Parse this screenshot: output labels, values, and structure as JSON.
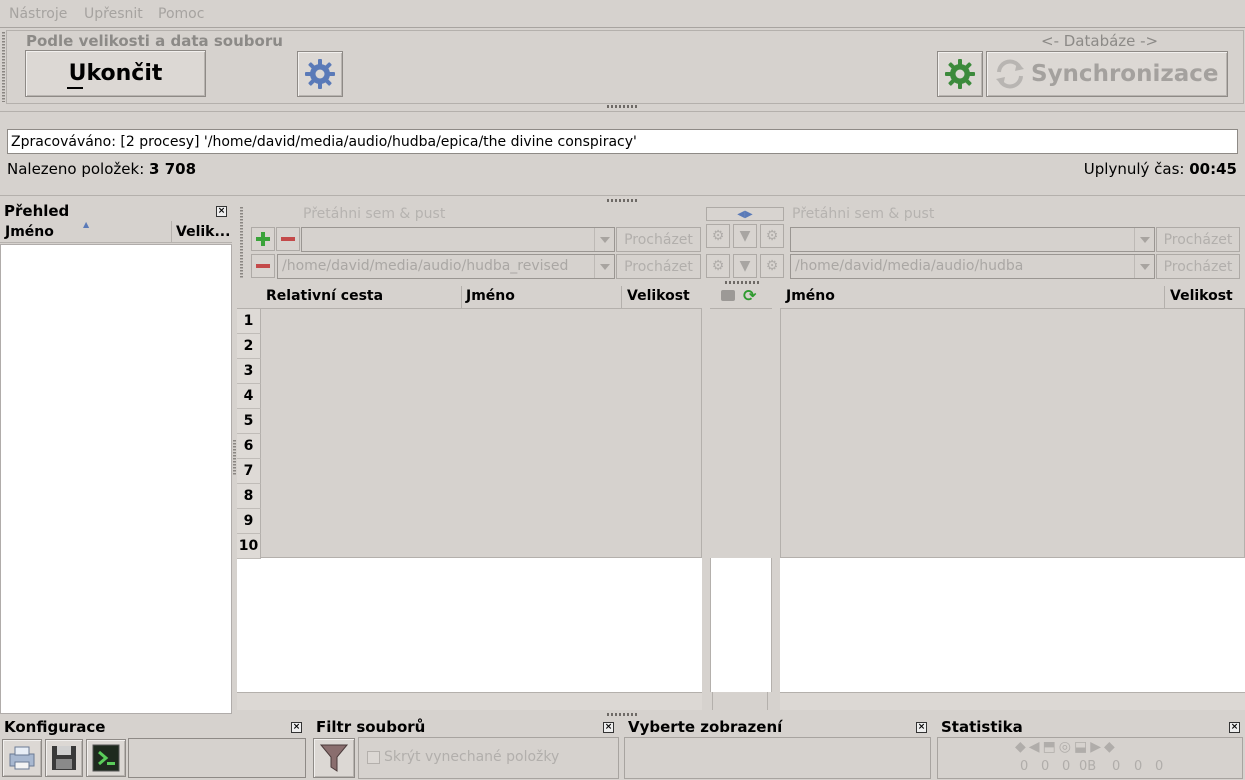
{
  "menu": {
    "items": [
      {
        "label": "Nástroje"
      },
      {
        "label": "Upřesnit"
      },
      {
        "label": "Pomoc"
      }
    ]
  },
  "toolbar": {
    "compare_mode": "Podle velikosti a data souboru",
    "quit_label": "Ukončit",
    "database_label": "<- Databáze ->",
    "sync_label": "Synchronizace"
  },
  "status": {
    "processing_text": "Zpracováváno: [2 procesy] '/home/david/media/audio/hudba/epica/the divine conspiracy'",
    "found_label": "Nalezeno položek:",
    "found_value": "3 708",
    "elapsed_label": "Uplynulý čas:",
    "elapsed_value": "00:45"
  },
  "overview": {
    "title": "Přehled",
    "col_name": "Jméno",
    "col_size": "Velik..."
  },
  "left_side": {
    "drop_hint": "Přetáhni sem & pust",
    "path_top": "",
    "path_bottom": "/home/david/media/audio/hudba_revised",
    "browse_label": "Procházet"
  },
  "right_side": {
    "drop_hint": "Přetáhni sem & pust",
    "path_top": "",
    "path_bottom": "/home/david/media/audio/hudba",
    "browse_label": "Procházet"
  },
  "left_grid": {
    "columns": [
      "Relativní cesta",
      "Jméno",
      "Velikost"
    ],
    "row_numbers": [
      "1",
      "2",
      "3",
      "4",
      "5",
      "6",
      "7",
      "8",
      "9",
      "10"
    ]
  },
  "right_grid": {
    "columns": [
      "Jméno",
      "Velikost"
    ]
  },
  "bottom": {
    "config_title": "Konfigurace",
    "filter_title": "Filtr souborů",
    "filter_checkbox": "Skrýt vynechané položky",
    "view_title": "Vyberte zobrazení",
    "stats_title": "Statistika",
    "stats_values": [
      "0",
      "0",
      "0",
      "0B",
      "0",
      "0",
      "0"
    ]
  },
  "colors": {
    "background": "#d6d2ce",
    "gear_blue": "#5a7ab8",
    "gear_green": "#3c8a3c",
    "plus_green": "#3aa33a",
    "minus_red": "#c44a4a"
  }
}
